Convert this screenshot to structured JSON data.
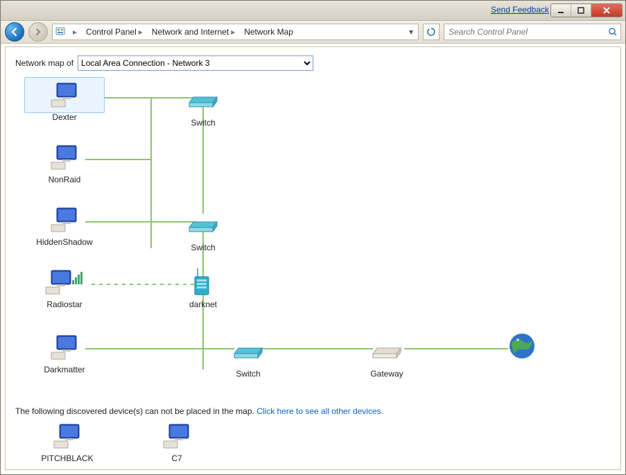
{
  "titlebar": {
    "feedback": "Send Feedback"
  },
  "breadcrumb": {
    "root_icon": "control-panel-icon",
    "items": [
      "Control Panel",
      "Network and Internet",
      "Network Map"
    ]
  },
  "search": {
    "placeholder": "Search Control Panel"
  },
  "selector": {
    "label": "Network map of",
    "value": "Local Area Connection - Network  3"
  },
  "nodes": {
    "dexter": {
      "label": "Dexter",
      "type": "computer",
      "selected": true
    },
    "nonraid": {
      "label": "NonRaid",
      "type": "computer"
    },
    "hiddenshadow": {
      "label": "HiddenShadow",
      "type": "computer"
    },
    "radiostar": {
      "label": "Radiostar",
      "type": "computer_wifi"
    },
    "darkmatter": {
      "label": "Darkmatter",
      "type": "computer"
    },
    "switch1": {
      "label": "Switch",
      "type": "switch"
    },
    "switch2": {
      "label": "Switch",
      "type": "switch"
    },
    "darknet": {
      "label": "darknet",
      "type": "router"
    },
    "switch3": {
      "label": "Switch",
      "type": "switch"
    },
    "gateway": {
      "label": "Gateway",
      "type": "gateway"
    },
    "internet": {
      "label": "",
      "type": "internet"
    }
  },
  "unplaced": {
    "message": "The following discovered device(s) can not be placed in the map.",
    "link": "Click here to see all other devices.",
    "items": {
      "pitchblack": {
        "label": "PITCHBLACK",
        "type": "computer"
      },
      "c7": {
        "label": "C7",
        "type": "computer"
      }
    }
  }
}
